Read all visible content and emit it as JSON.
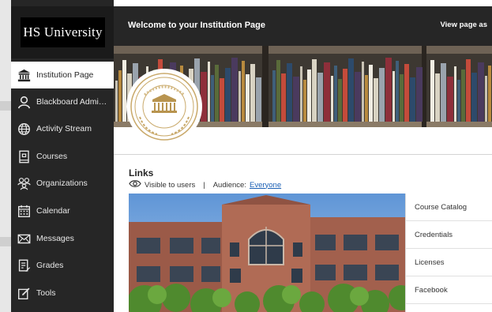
{
  "brand": {
    "logo_text": "HS University"
  },
  "header": {
    "title": "Welcome to your Institution Page",
    "view_as": "View page as"
  },
  "sidebar": {
    "items": [
      {
        "label": "Institution Page",
        "icon": "institution-icon",
        "active": true
      },
      {
        "label": "Blackboard Admini...",
        "icon": "user-icon"
      },
      {
        "label": "Activity Stream",
        "icon": "globe-icon"
      },
      {
        "label": "Courses",
        "icon": "book-icon"
      },
      {
        "label": "Organizations",
        "icon": "organizations-icon"
      },
      {
        "label": "Calendar",
        "icon": "calendar-icon"
      },
      {
        "label": "Messages",
        "icon": "envelope-icon"
      },
      {
        "label": "Grades",
        "icon": "grades-icon"
      },
      {
        "label": "Tools",
        "icon": "tools-icon"
      }
    ]
  },
  "links": {
    "title": "Links",
    "visibility": "Visible to users",
    "separator": "|",
    "audience_label": "Audience:",
    "audience_value": "Everyone",
    "items": [
      "Course Catalog",
      "Credentials",
      "Licenses",
      "Facebook"
    ]
  },
  "colors": {
    "sidebar_bg": "#262626",
    "header_bg": "#262626",
    "link": "#1a5fb4"
  }
}
